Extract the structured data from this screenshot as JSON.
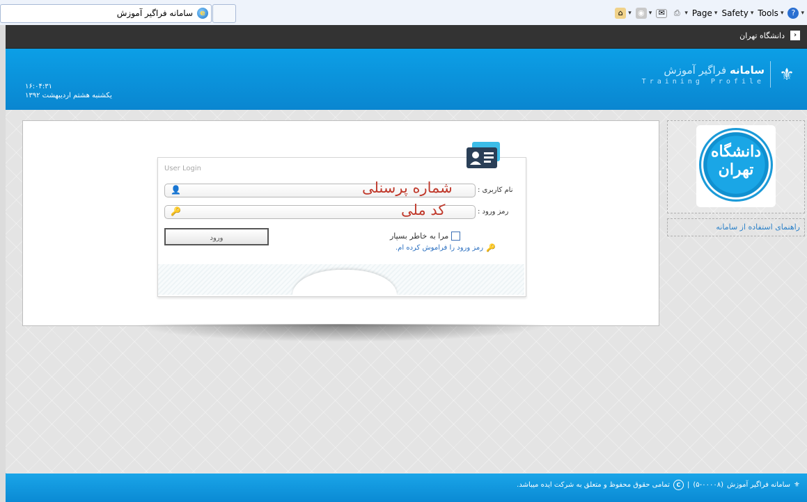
{
  "browser": {
    "tab_title": "سامانه فراگیر آموزش",
    "commands": [
      "Page",
      "Safety",
      "Tools"
    ]
  },
  "topbar": {
    "university_link": "دانشگاه تهران"
  },
  "header": {
    "brand_bold": "سامانه",
    "brand_rest": " فراگیر آموزش",
    "brand_sub": "Training Profile",
    "clock": "۱۶:۰۴:۳۱",
    "date": "یکشنبه هشتم اردیبهشت ۱۳۹۲"
  },
  "sidebar": {
    "emblem_text": "دانشگاه تهران",
    "guide_link": "راهنمای استفاده از سامانه"
  },
  "login": {
    "title": "User Login",
    "username_label": "نام کاربری :",
    "username_hint": "شماره پرسنلی",
    "password_label": "رمز ورود :",
    "password_hint": "کد ملی",
    "submit_label": "ورود",
    "remember_label": "مرا به خاطر بسپار",
    "forgot_link": "رمز ورود را فراموش کرده ام."
  },
  "footer": {
    "system_name": "سامانه فراگیر آموزش",
    "version": "(۵-۰۰۰۰۸)",
    "rights": "تمامی حقوق محفوظ و متعلق به شرکت ایده میباشد."
  },
  "colors": {
    "header_blue": "#0a86d0",
    "hint_red": "#c0392b",
    "link_blue": "#2a6fc0"
  }
}
